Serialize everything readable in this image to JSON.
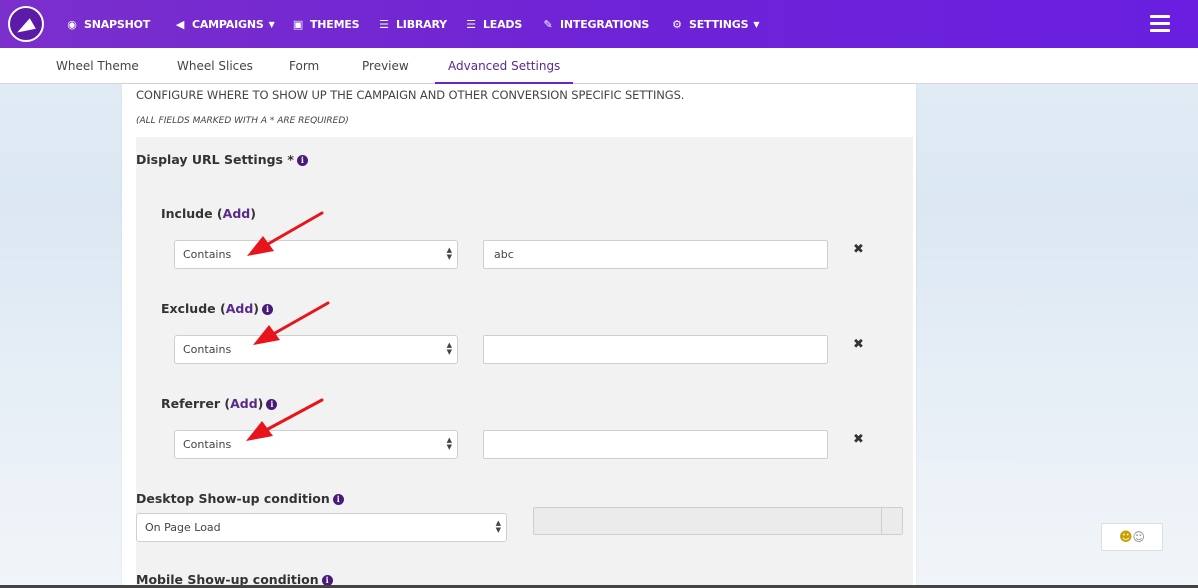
{
  "nav": {
    "items": [
      {
        "label": "SNAPSHOT",
        "icon": "dashboard-icon",
        "glyph": "◉"
      },
      {
        "label": "CAMPAIGNS",
        "icon": "send-icon",
        "glyph": "◀",
        "dropdown": true
      },
      {
        "label": "THEMES",
        "icon": "image-icon",
        "glyph": "▣"
      },
      {
        "label": "LIBRARY",
        "icon": "list-alt-icon",
        "glyph": "☰"
      },
      {
        "label": "LEADS",
        "icon": "list-icon",
        "glyph": "☰"
      },
      {
        "label": "INTEGRATIONS",
        "icon": "plug-icon",
        "glyph": "✎"
      },
      {
        "label": "SETTINGS",
        "icon": "cogs-icon",
        "glyph": "⚙",
        "dropdown": true
      }
    ]
  },
  "tabs": [
    "Wheel Theme",
    "Wheel Slices",
    "Form",
    "Preview",
    "Advanced Settings"
  ],
  "active_tab": "Advanced Settings",
  "content": {
    "configure_text": "CONFIGURE WHERE TO SHOW UP THE CAMPAIGN AND OTHER CONVERSION SPECIFIC SETTINGS.",
    "required_note": "(ALL FIELDS MARKED WITH A * ARE REQUIRED)",
    "display_url_title": "Display URL Settings *",
    "include": {
      "label": "Include",
      "add": "Add",
      "select": "Contains",
      "value": "abc"
    },
    "exclude": {
      "label": "Exclude",
      "add": "Add",
      "select": "Contains",
      "value": ""
    },
    "referrer": {
      "label": "Referrer",
      "add": "Add",
      "select": "Contains",
      "value": ""
    },
    "remove_glyph": "✖",
    "desktop_title": "Desktop Show-up condition",
    "desktop_select": "On Page Load",
    "mobile_title": "Mobile Show-up condition"
  },
  "colors": {
    "nav_bg": "#6f23d6",
    "accent": "#5a2a8a",
    "arrow": "#e8141b"
  }
}
